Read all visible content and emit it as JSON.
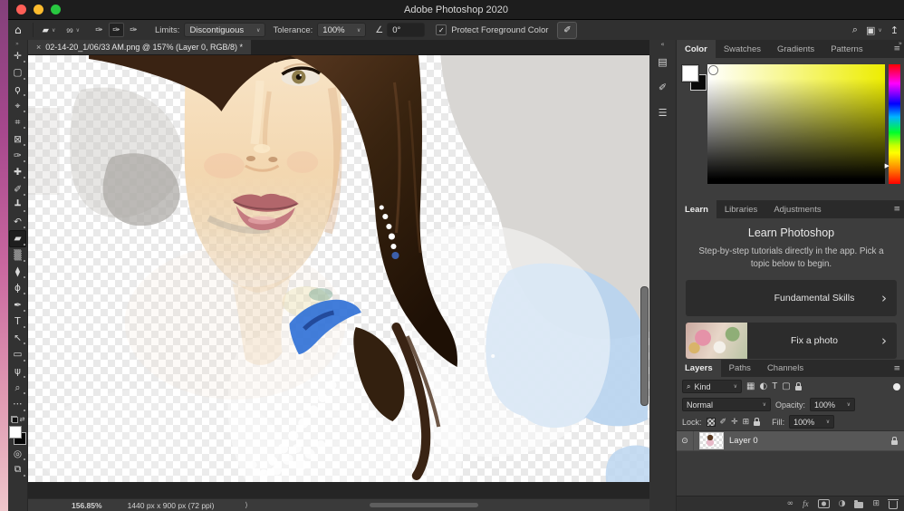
{
  "ui": {
    "caret": "∨",
    "menu_glyph": "≡"
  },
  "window": {
    "title": "Adobe Photoshop 2020",
    "traffic_light_colors": {
      "close": "#ff5f57",
      "minimize": "#febc2e",
      "zoom": "#28c840"
    }
  },
  "options_bar": {
    "home_glyph": "⌂",
    "tool_glyph": "▰",
    "brush_size": "99",
    "sampling_glyph": "✑",
    "limits_label": "Limits:",
    "limits_value": "Discontiguous",
    "tolerance_label": "Tolerance:",
    "tolerance_value": "100%",
    "angle_glyph": "∠",
    "angle_value": "0°",
    "check_glyph": "✓",
    "protect_label": "Protect Foreground Color",
    "pen_pressure_glyph": "✐",
    "search_glyph": "⌕",
    "workspace_glyph": "▣",
    "share_glyph": "↥"
  },
  "toolbar": {
    "collapse_glyph": "»",
    "swap_glyph": "⇄",
    "tools": [
      {
        "name": "move-tool",
        "glyph": "✛"
      },
      {
        "name": "rectangular-marquee-tool",
        "glyph": "▢"
      },
      {
        "name": "lasso-tool",
        "glyph": "ϙ"
      },
      {
        "name": "object-selection-tool",
        "glyph": "⌖"
      },
      {
        "name": "crop-tool",
        "glyph": "⌗"
      },
      {
        "name": "frame-tool",
        "glyph": "⊠"
      },
      {
        "name": "eyedropper-tool",
        "glyph": "✑"
      },
      {
        "name": "spot-healing-brush-tool",
        "glyph": "✚"
      },
      {
        "name": "brush-tool",
        "glyph": "✐"
      },
      {
        "name": "clone-stamp-tool",
        "glyph": "┻"
      },
      {
        "name": "history-brush-tool",
        "glyph": "↶"
      },
      {
        "name": "background-eraser-tool",
        "glyph": "▰",
        "selected": true
      },
      {
        "name": "gradient-tool",
        "glyph": "▒"
      },
      {
        "name": "blur-tool",
        "glyph": "⧫"
      },
      {
        "name": "dodge-tool",
        "glyph": "ϕ"
      },
      {
        "name": "pen-tool",
        "glyph": "✒"
      },
      {
        "name": "type-tool",
        "glyph": "T"
      },
      {
        "name": "path-selection-tool",
        "glyph": "↖"
      },
      {
        "name": "shape-tool",
        "glyph": "▭"
      },
      {
        "name": "hand-tool",
        "glyph": "ψ"
      },
      {
        "name": "zoom-tool",
        "glyph": "⌕"
      },
      {
        "name": "edit-toolbar-button",
        "glyph": "⋯"
      }
    ],
    "tools_bottom": [
      {
        "name": "quick-mask-button",
        "glyph": "◎"
      },
      {
        "name": "screen-mode-button",
        "glyph": "⧉"
      }
    ]
  },
  "document_tab": {
    "close_glyph": "×",
    "title": "02-14-20_1/06/33 AM.png @ 157% (Layer 0, RGB/8) *"
  },
  "panel_strip": {
    "collapse_glyph": "«",
    "icons": [
      {
        "name": "properties-panel-icon",
        "glyph": "▤"
      },
      {
        "name": "brush-settings-panel-icon",
        "glyph": "✐"
      },
      {
        "name": "sliders-panel-icon",
        "glyph": "☰"
      }
    ]
  },
  "dock": {
    "collapse_glyph": "»"
  },
  "color_panel": {
    "tabs": [
      "Color",
      "Swatches",
      "Gradients",
      "Patterns"
    ],
    "active_tab": "Color",
    "hue_marker_glyph": "▶",
    "field_color": "#eded00"
  },
  "learn_panel": {
    "tabs": [
      "Learn",
      "Libraries",
      "Adjustments"
    ],
    "active_tab": "Learn",
    "title": "Learn Photoshop",
    "subtitle": "Step-by-step tutorials directly in the app. Pick a topic below to begin.",
    "cards": [
      {
        "label": "Fundamental Skills",
        "chevron": "›"
      },
      {
        "label": "Fix a photo",
        "chevron": "›"
      }
    ]
  },
  "layers_panel": {
    "tabs": [
      "Layers",
      "Paths",
      "Channels"
    ],
    "active_tab": "Layers",
    "search_glyph": "⌕",
    "kind_label": "Kind",
    "filter_icons": [
      {
        "name": "image-filter-icon",
        "glyph": "▦"
      },
      {
        "name": "adjustment-filter-icon",
        "glyph": "◐"
      },
      {
        "name": "type-filter-icon",
        "glyph": "T"
      },
      {
        "name": "shape-filter-icon",
        "glyph": "▢"
      }
    ],
    "blend_mode": "Normal",
    "opacity_label": "Opacity:",
    "opacity_value": "100%",
    "lock_label": "Lock:",
    "lock_brush_glyph": "✐",
    "lock_move_glyph": "✛",
    "lock_artboard_glyph": "⊞",
    "fill_label": "Fill:",
    "fill_value": "100%",
    "eye_glyph": "⊙",
    "layer_name": "Layer 0",
    "footer_icons": [
      {
        "name": "link-layers-icon",
        "glyph": "∞"
      },
      {
        "name": "layer-style-icon",
        "glyph": "fx"
      },
      {
        "name": "adjustment-layer-icon",
        "glyph": "◑"
      },
      {
        "name": "new-layer-icon",
        "glyph": "⊞"
      }
    ]
  },
  "status_bar": {
    "zoom_level": "156.85%",
    "doc_info": "1440 px x 900 px (72 ppi)",
    "chevron": "⟩"
  },
  "canvas": {
    "content": "partially-erased portrait of woman over transparency checkerboard",
    "accent_blue": "#2e6fd6",
    "selection_blue": "#b9d4ef",
    "background_gray": "#d8d6d3"
  }
}
